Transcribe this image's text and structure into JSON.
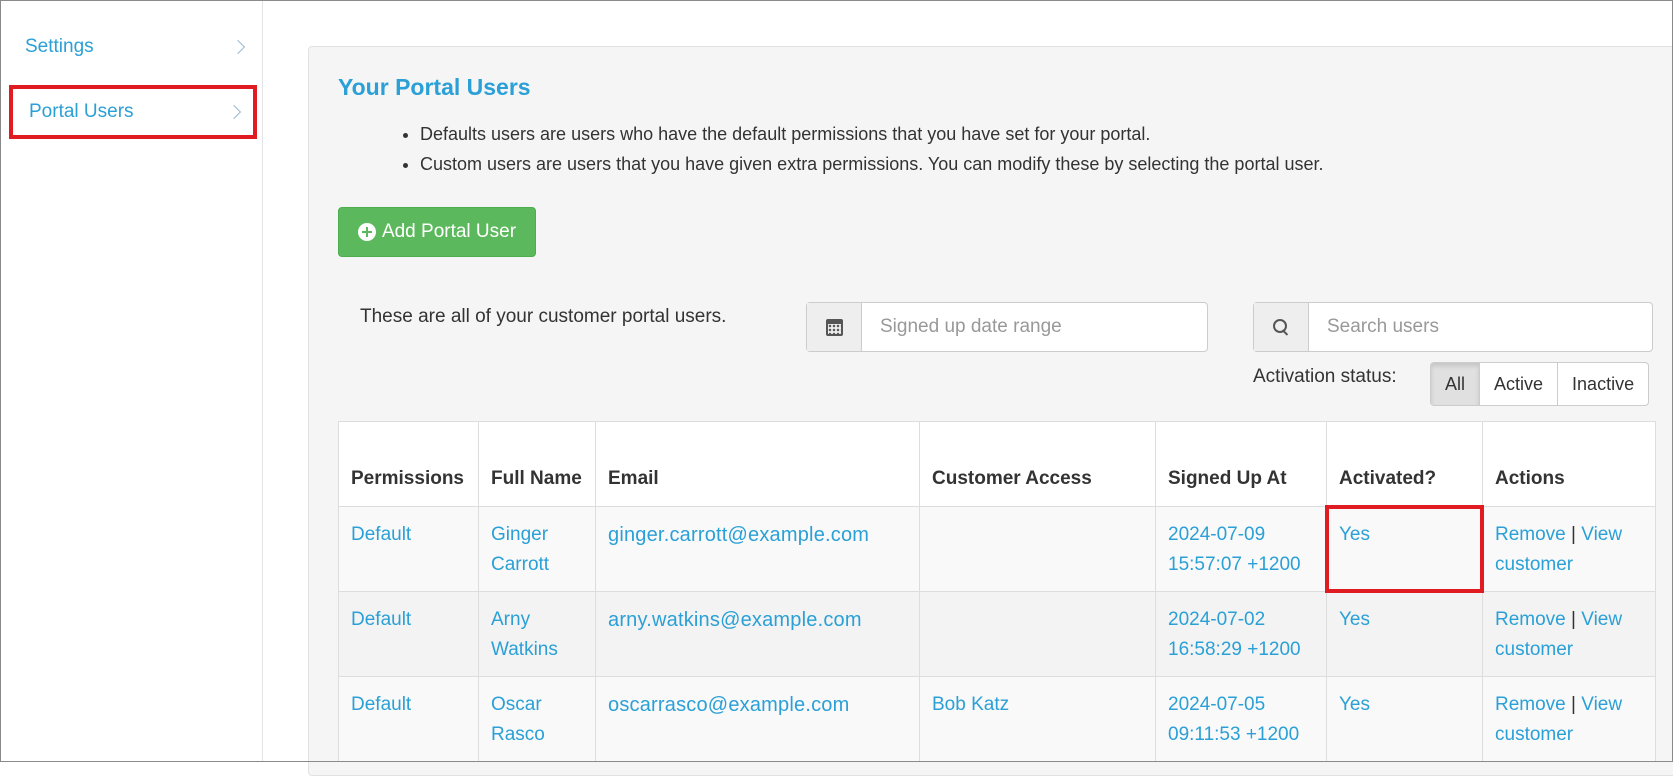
{
  "sidebar": {
    "items": [
      {
        "label": "Settings"
      },
      {
        "label": "Portal Users"
      }
    ]
  },
  "main": {
    "title": "Your Portal Users",
    "bullets": [
      "Defaults users are users who have the default permissions that you have set for your portal.",
      "Custom users are users that you have given extra permissions. You can modify these by selecting the portal user."
    ],
    "add_button_label": "Add Portal User",
    "intro_text": "These are all of your customer portal users.",
    "date_range_placeholder": "Signed up date range",
    "search_placeholder": "Search users",
    "activation_status_label": "Activation status:",
    "activation_filters": [
      "All",
      "Active",
      "Inactive"
    ],
    "activation_filter_selected": "All"
  },
  "table": {
    "headers": [
      "Permissions",
      "Full Name",
      "Email",
      "Customer Access",
      "Signed Up At",
      "Activated?",
      "Actions"
    ],
    "rows": [
      {
        "permissions": "Default",
        "full_name": "Ginger Carrott",
        "email": "ginger.carrott@example.com",
        "customer_access": "",
        "signed_up_at": "2024-07-09 15:57:07 +1200",
        "activated": "Yes",
        "action_remove": "Remove",
        "action_separator": "|",
        "action_view": "View customer"
      },
      {
        "permissions": "Default",
        "full_name": "Arny Watkins",
        "email": "arny.watkins@example.com",
        "customer_access": "",
        "signed_up_at": "2024-07-02 16:58:29 +1200",
        "activated": "Yes",
        "action_remove": "Remove",
        "action_separator": "|",
        "action_view": "View customer"
      },
      {
        "permissions": "Default",
        "full_name": "Oscar Rasco",
        "email": "oscarrasco@example.com",
        "customer_access": "Bob Katz",
        "signed_up_at": "2024-07-05 09:11:53 +1200",
        "activated": "Yes",
        "action_remove": "Remove",
        "action_separator": "|",
        "action_view": "View customer"
      }
    ]
  },
  "colors": {
    "link": "#2aa0d6",
    "primary_green": "#5cb85c",
    "highlight_red": "#e01b22"
  },
  "icons": {
    "sidebar_chevron": "chevron-right-icon",
    "add": "plus-circle-icon",
    "date": "calendar-icon",
    "search": "search-icon"
  }
}
